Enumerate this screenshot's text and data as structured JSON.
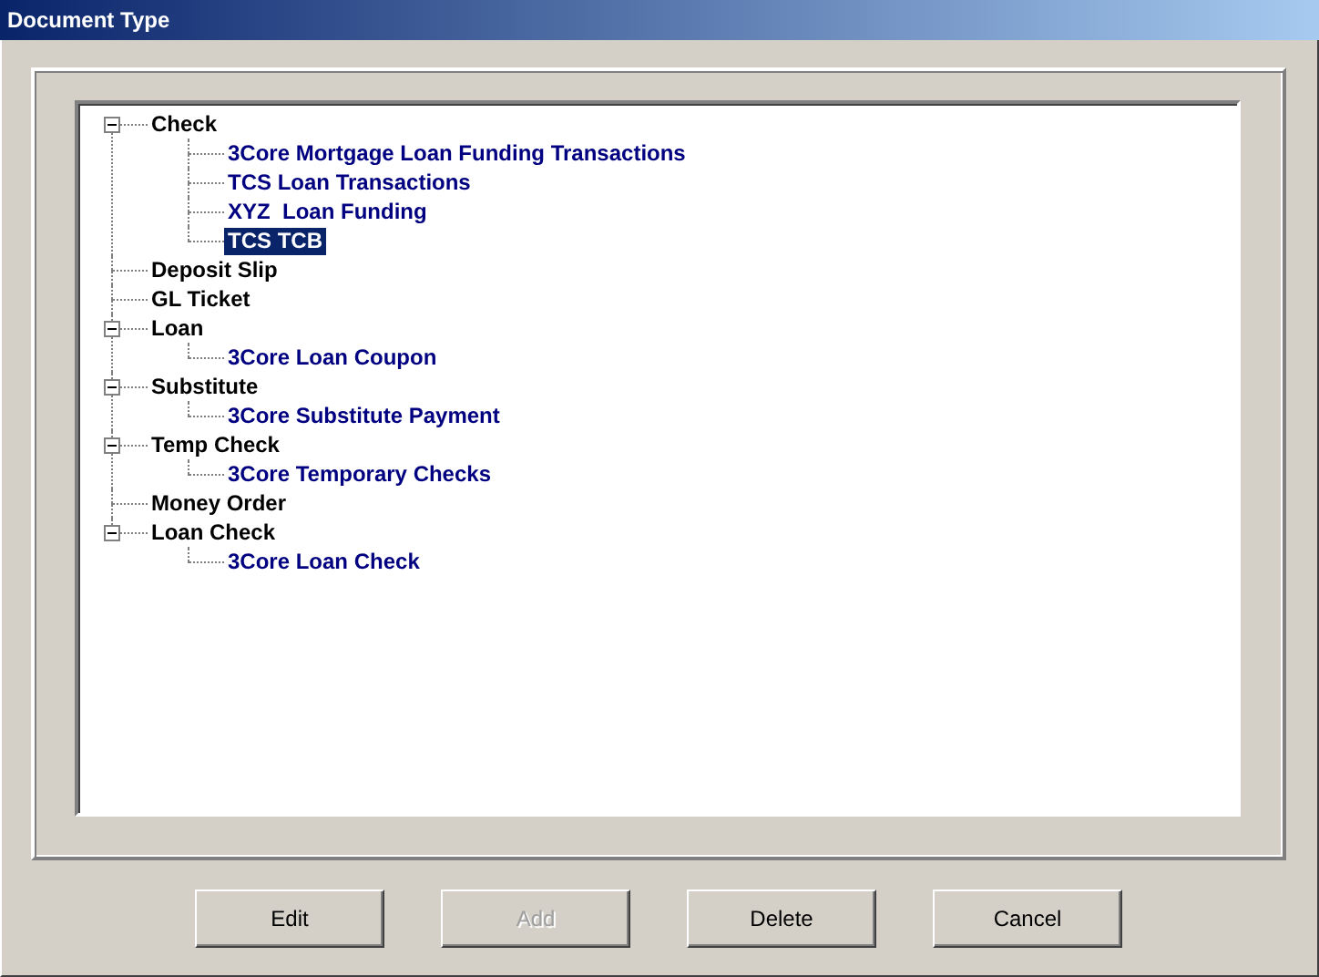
{
  "window": {
    "title": "Document Type"
  },
  "tree": {
    "items": [
      {
        "label": "Check",
        "expanded": true,
        "selected": false,
        "children": [
          {
            "label": "3Core Mortgage Loan Funding Transactions",
            "selected": false
          },
          {
            "label": "TCS Loan Transactions",
            "selected": false
          },
          {
            "label": "XYZ  Loan Funding",
            "selected": false
          },
          {
            "label": "TCS TCB",
            "selected": true
          }
        ]
      },
      {
        "label": "Deposit Slip",
        "selected": false
      },
      {
        "label": "GL Ticket",
        "selected": false
      },
      {
        "label": "Loan",
        "expanded": true,
        "selected": false,
        "children": [
          {
            "label": "3Core Loan Coupon",
            "selected": false
          }
        ]
      },
      {
        "label": "Substitute",
        "expanded": true,
        "selected": false,
        "children": [
          {
            "label": "3Core Substitute Payment",
            "selected": false
          }
        ]
      },
      {
        "label": "Temp Check",
        "expanded": true,
        "selected": false,
        "children": [
          {
            "label": "3Core Temporary Checks",
            "selected": false
          }
        ]
      },
      {
        "label": "Money Order",
        "selected": false
      },
      {
        "label": "Loan Check",
        "expanded": true,
        "selected": false,
        "children": [
          {
            "label": "3Core Loan Check",
            "selected": false
          }
        ]
      }
    ]
  },
  "buttons": [
    {
      "label": "Edit",
      "disabled": false
    },
    {
      "label": "Add",
      "disabled": true
    },
    {
      "label": "Delete",
      "disabled": false
    },
    {
      "label": "Cancel",
      "disabled": false
    }
  ]
}
